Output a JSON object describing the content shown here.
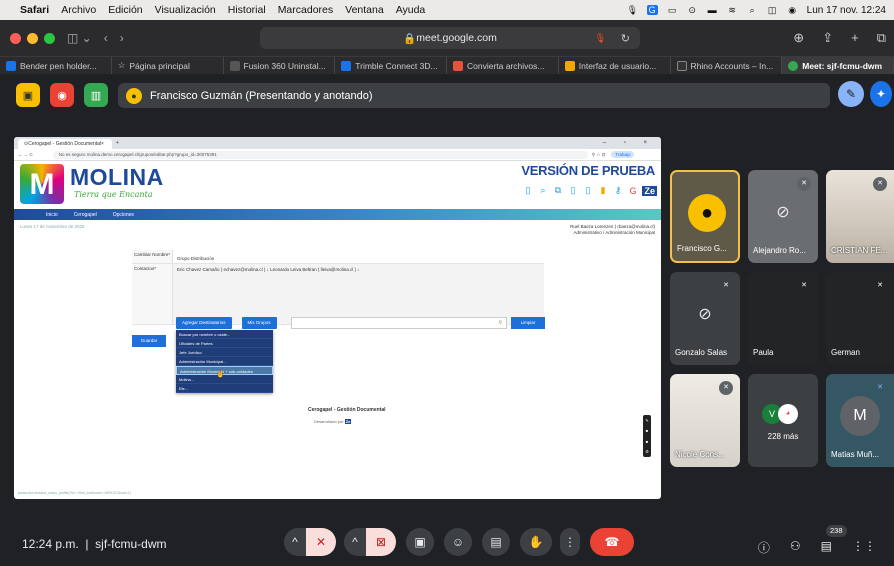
{
  "menubar": {
    "app": "Safari",
    "items": [
      "Archivo",
      "Edición",
      "Visualización",
      "Historial",
      "Marcadores",
      "Ventana",
      "Ayuda"
    ],
    "clock": "Lun 17 nov. 12:24"
  },
  "safari": {
    "url": "meet.google.com",
    "favorites": [
      {
        "label": "Bender pen holder...",
        "color": "#1a73e8"
      },
      {
        "label": "Página principal",
        "color": "#777"
      },
      {
        "label": "Fusion 360 Uninstal...",
        "color": "#555"
      },
      {
        "label": "Trimble Connect 3D...",
        "color": "#1a73e8"
      },
      {
        "label": "Convierta archivos...",
        "color": "#e5533d"
      },
      {
        "label": "Interfaz de usuario...",
        "color": "#f4a700"
      },
      {
        "label": "Rhino Accounts – In...",
        "color": "#333"
      },
      {
        "label": "Meet: sjf-fcmu-dwm",
        "color": "#34a853"
      }
    ]
  },
  "meet": {
    "presenting": "Francisco Guzmán (Presentando y anotando)",
    "time": "12:24 p.m.",
    "meeting_code": "sjf-fcmu-dwm",
    "participant_count": "238",
    "tiles": [
      {
        "name": "Francisco G..."
      },
      {
        "name": "Alejandro Ro..."
      },
      {
        "name": "CRISTIAN FE..."
      },
      {
        "name": "Gonzalo Salas"
      },
      {
        "name": "Paula"
      },
      {
        "name": "German"
      },
      {
        "name": "Nicole Cons..."
      },
      {
        "more": "228 más",
        "avatar": "V"
      },
      {
        "name": "Matias Muñ...",
        "avatar": "M"
      }
    ]
  },
  "shared": {
    "tab": "Cerogapel - Gestión Documental",
    "url": "No es seguro   molina.demo.cerogapel.cl/grupos/editar.php?grupo_id=30075391",
    "profile": "Trabajo",
    "logo": "MOLINA",
    "logo_sub": "Tierra que Encanta",
    "version": "VERSIÓN DE PRUEBA",
    "nav": [
      "Inicio",
      "Cerogapel",
      "Opciones"
    ],
    "date": "Lunes 17 de noviembre de 2025",
    "user": [
      "Ruel Baeza Lorenzen ( rbaeza@molina.cl)",
      "Administrativo / Administración Municipal"
    ],
    "form": {
      "name_label": "Cambiar Nombre*",
      "name_value": "Grupo Distribución",
      "contacts_label": "Contactos*",
      "contacts": "Eric Chavez Camaño ( echavez@molina.cl )  ↓    Leonardo Leiva Beltran ( lleiva@molina.cl )  ↓"
    },
    "btn_add": "Agregar Destinatarios",
    "btn_groups": "Mis Grupos",
    "btn_clear": "Limpiar",
    "btn_save": "Guardar",
    "dropdown": [
      "Buscar por nombre o oside...",
      "Oficiales de Partes",
      "Jefe Jurídico",
      "Administración Municipal...",
      "Administración Municipal + sub-unidades",
      "Molina...",
      "Ele..."
    ],
    "footer_title": "Cerogapel - Gestión Documental",
    "footer_sub": "Desarrollado por",
    "footer_logo": "Ze",
    "status": "javascript:ventana_carpo_profile(?id=~/libri_institucion~3699197&sub=1)"
  }
}
